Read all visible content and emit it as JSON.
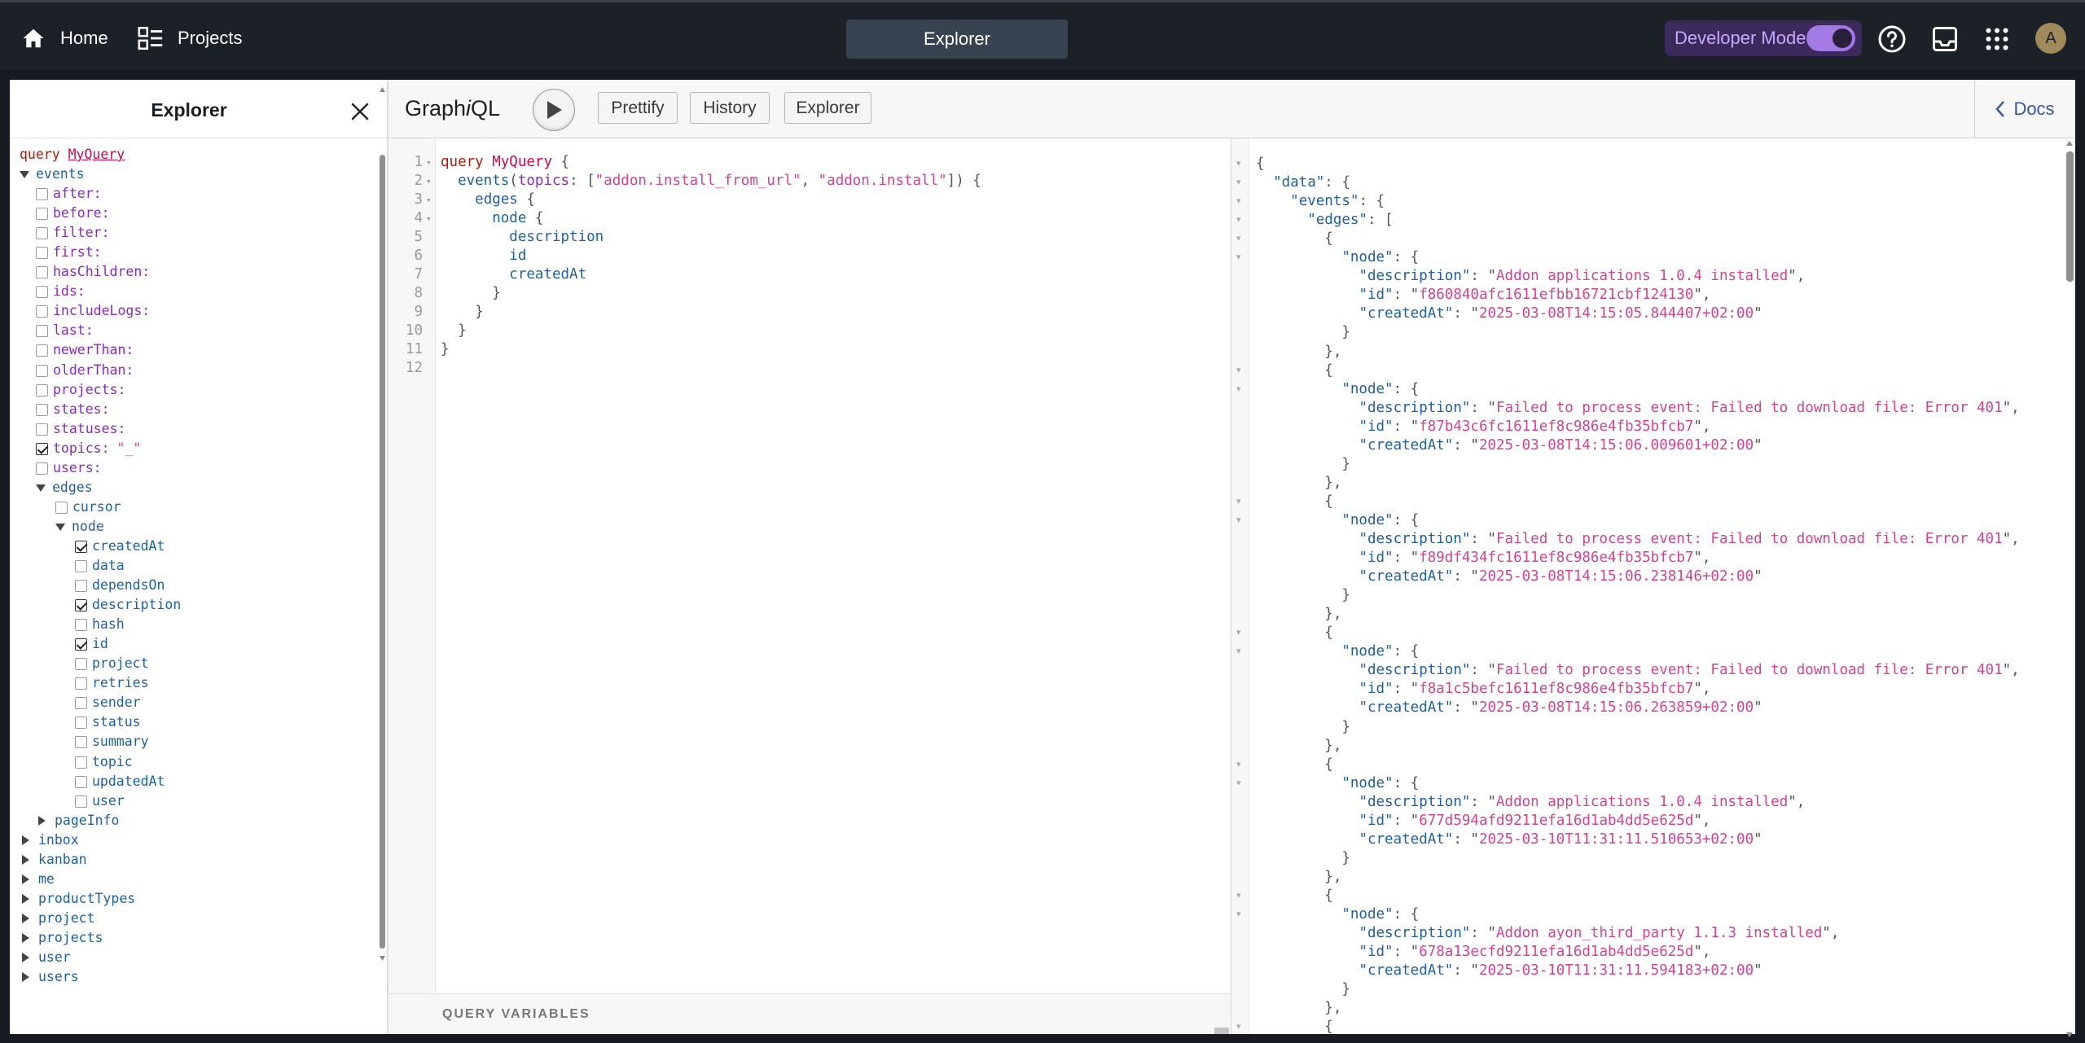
{
  "topbar": {
    "home_label": "Home",
    "projects_label": "Projects",
    "center_tab": "Explorer",
    "dev_mode_label": "Developer Mode",
    "dev_mode_enabled": true,
    "avatar_letter": "A",
    "accent": "#a37ae3"
  },
  "explorer": {
    "title": "Explorer",
    "query_keyword": "query",
    "query_name": "MyQuery",
    "tree": [
      {
        "label": "events",
        "kind": "field",
        "expanded": true,
        "indent": 0
      },
      {
        "label": "after:",
        "kind": "arg",
        "checked": false,
        "indent": 1
      },
      {
        "label": "before:",
        "kind": "arg",
        "checked": false,
        "indent": 1
      },
      {
        "label": "filter:",
        "kind": "arg",
        "checked": false,
        "indent": 1
      },
      {
        "label": "first:",
        "kind": "arg",
        "checked": false,
        "indent": 1
      },
      {
        "label": "hasChildren:",
        "kind": "arg",
        "checked": false,
        "indent": 1
      },
      {
        "label": "ids:",
        "kind": "arg",
        "checked": false,
        "indent": 1
      },
      {
        "label": "includeLogs:",
        "kind": "arg",
        "checked": false,
        "indent": 1
      },
      {
        "label": "last:",
        "kind": "arg",
        "checked": false,
        "indent": 1
      },
      {
        "label": "newerThan:",
        "kind": "arg",
        "checked": false,
        "indent": 1
      },
      {
        "label": "olderThan:",
        "kind": "arg",
        "checked": false,
        "indent": 1
      },
      {
        "label": "projects:",
        "kind": "arg",
        "checked": false,
        "indent": 1
      },
      {
        "label": "states:",
        "kind": "arg",
        "checked": false,
        "indent": 1
      },
      {
        "label": "statuses:",
        "kind": "arg",
        "checked": false,
        "indent": 1
      },
      {
        "label": "topics:",
        "kind": "arg",
        "checked": true,
        "value": "\"_\"",
        "indent": 1
      },
      {
        "label": "users:",
        "kind": "arg",
        "checked": false,
        "indent": 1
      },
      {
        "label": "edges",
        "kind": "field",
        "expanded": true,
        "indent": 1
      },
      {
        "label": "cursor",
        "kind": "leaf",
        "checked": false,
        "indent": 2
      },
      {
        "label": "node",
        "kind": "field",
        "expanded": true,
        "indent": 2
      },
      {
        "label": "createdAt",
        "kind": "leaf",
        "checked": true,
        "indent": 3
      },
      {
        "label": "data",
        "kind": "leaf",
        "checked": false,
        "indent": 3
      },
      {
        "label": "dependsOn",
        "kind": "leaf",
        "checked": false,
        "indent": 3
      },
      {
        "label": "description",
        "kind": "leaf",
        "checked": true,
        "indent": 3
      },
      {
        "label": "hash",
        "kind": "leaf",
        "checked": false,
        "indent": 3
      },
      {
        "label": "id",
        "kind": "leaf",
        "checked": true,
        "indent": 3
      },
      {
        "label": "project",
        "kind": "leaf",
        "checked": false,
        "indent": 3
      },
      {
        "label": "retries",
        "kind": "leaf",
        "checked": false,
        "indent": 3
      },
      {
        "label": "sender",
        "kind": "leaf",
        "checked": false,
        "indent": 3
      },
      {
        "label": "status",
        "kind": "leaf",
        "checked": false,
        "indent": 3
      },
      {
        "label": "summary",
        "kind": "leaf",
        "checked": false,
        "indent": 3
      },
      {
        "label": "topic",
        "kind": "leaf",
        "checked": false,
        "indent": 3
      },
      {
        "label": "updatedAt",
        "kind": "leaf",
        "checked": false,
        "indent": 3
      },
      {
        "label": "user",
        "kind": "leaf",
        "checked": false,
        "indent": 3
      },
      {
        "label": "pageInfo",
        "kind": "field",
        "expanded": false,
        "indent": 1
      },
      {
        "label": "inbox",
        "kind": "field",
        "expanded": false,
        "indent": 0
      },
      {
        "label": "kanban",
        "kind": "field",
        "expanded": false,
        "indent": 0
      },
      {
        "label": "me",
        "kind": "field",
        "expanded": false,
        "indent": 0
      },
      {
        "label": "productTypes",
        "kind": "field",
        "expanded": false,
        "indent": 0
      },
      {
        "label": "project",
        "kind": "field",
        "expanded": false,
        "indent": 0
      },
      {
        "label": "projects",
        "kind": "field",
        "expanded": false,
        "indent": 0
      },
      {
        "label": "user",
        "kind": "field",
        "expanded": false,
        "indent": 0
      },
      {
        "label": "users",
        "kind": "field",
        "expanded": false,
        "indent": 0
      }
    ]
  },
  "graphiql": {
    "title_pre": "Graph",
    "title_i": "i",
    "title_post": "QL",
    "prettify_label": "Prettify",
    "history_label": "History",
    "explorer_label": "Explorer",
    "docs_label": "Docs",
    "query_variables_label": "QUERY VARIABLES",
    "query_lines": [
      [
        [
          "kw",
          "query"
        ],
        [
          "p",
          " "
        ],
        [
          "def",
          "MyQuery"
        ],
        [
          "p",
          " {"
        ]
      ],
      [
        [
          "p",
          "  "
        ],
        [
          "field",
          "events"
        ],
        [
          "p",
          "("
        ],
        [
          "arg",
          "topics"
        ],
        [
          "p",
          ": ["
        ],
        [
          "str",
          "\"addon.install_from_url\""
        ],
        [
          "p",
          ", "
        ],
        [
          "str",
          "\"addon.install\""
        ],
        [
          "p",
          "]) {"
        ]
      ],
      [
        [
          "p",
          "    "
        ],
        [
          "field",
          "edges"
        ],
        [
          "p",
          " {"
        ]
      ],
      [
        [
          "p",
          "      "
        ],
        [
          "field",
          "node"
        ],
        [
          "p",
          " {"
        ]
      ],
      [
        [
          "p",
          "        "
        ],
        [
          "field",
          "description"
        ]
      ],
      [
        [
          "p",
          "        "
        ],
        [
          "field",
          "id"
        ]
      ],
      [
        [
          "p",
          "        "
        ],
        [
          "field",
          "createdAt"
        ]
      ],
      [
        [
          "p",
          "      }"
        ]
      ],
      [
        [
          "p",
          "    }"
        ]
      ],
      [
        [
          "p",
          "  }"
        ]
      ],
      [
        [
          "p",
          "}"
        ]
      ],
      [
        [
          "p",
          ""
        ]
      ]
    ],
    "query_folds": [
      true,
      true,
      true,
      true,
      false,
      false,
      false,
      false,
      false,
      false,
      false,
      false
    ],
    "result": {
      "events": [
        {
          "description": "Addon applications 1.0.4 installed",
          "id": "f860840afc1611efbb16721cbf124130",
          "createdAt": "2025-03-08T14:15:05.844407+02:00"
        },
        {
          "description": "Failed to process event: Failed to download file: Error 401",
          "id": "f87b43c6fc1611ef8c986e4fb35bfcb7",
          "createdAt": "2025-03-08T14:15:06.009601+02:00"
        },
        {
          "description": "Failed to process event: Failed to download file: Error 401",
          "id": "f89df434fc1611ef8c986e4fb35bfcb7",
          "createdAt": "2025-03-08T14:15:06.238146+02:00"
        },
        {
          "description": "Failed to process event: Failed to download file: Error 401",
          "id": "f8a1c5befc1611ef8c986e4fb35bfcb7",
          "createdAt": "2025-03-08T14:15:06.263859+02:00"
        },
        {
          "description": "Addon applications 1.0.4 installed",
          "id": "677d594afd9211efa16d1ab4dd5e625d",
          "createdAt": "2025-03-10T11:31:11.510653+02:00"
        },
        {
          "description": "Addon ayon_third_party 1.1.3 installed",
          "id": "678a13ecfd9211efa16d1ab4dd5e625d",
          "createdAt": "2025-03-10T11:31:11.594183+02:00"
        }
      ]
    }
  }
}
